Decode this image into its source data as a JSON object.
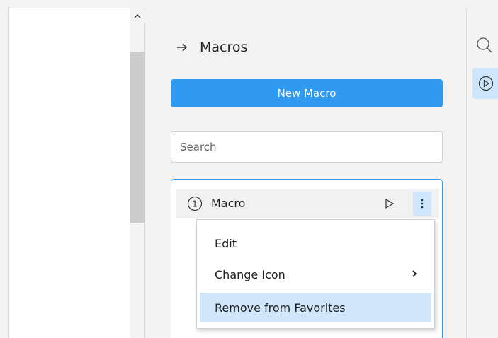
{
  "panel": {
    "title": "Macros",
    "new_macro_label": "New Macro",
    "search_placeholder": "Search"
  },
  "macro_list": {
    "items": [
      {
        "icon_number": "1",
        "name": "Macro"
      }
    ]
  },
  "context_menu": {
    "items": [
      {
        "label": "Edit"
      },
      {
        "label": "Change Icon"
      },
      {
        "label": "Remove from Favorites"
      }
    ]
  },
  "colors": {
    "accent": "#2f9af0",
    "highlight": "#cfe6fb"
  },
  "icons": {
    "back_arrow": "arrow-right-icon",
    "macro_icon": "circled-number-one-icon",
    "play": "play-icon",
    "more": "vertical-ellipsis-icon",
    "submenu": "chevron-right-icon",
    "rail_search": "search-icon",
    "rail_macros": "play-circle-icon",
    "scroll_up": "chevron-up-icon"
  }
}
